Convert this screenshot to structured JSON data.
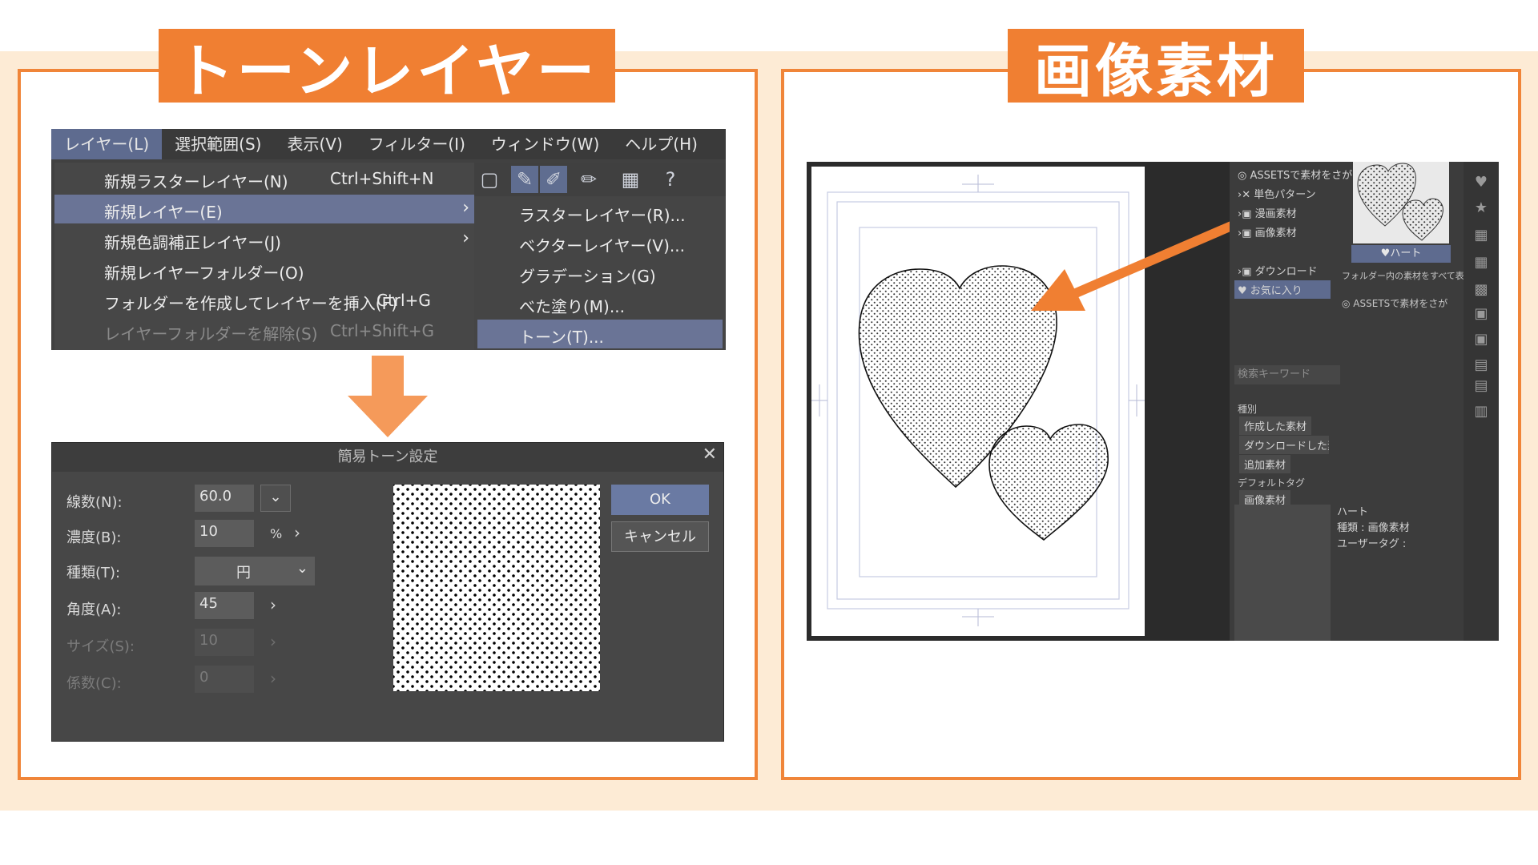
{
  "left_panel": {
    "title": "トーンレイヤー",
    "menubar": [
      "レイヤー(L)",
      "選択範囲(S)",
      "表示(V)",
      "フィルター(I)",
      "ウィンドウ(W)",
      "ヘルプ(H)"
    ],
    "layer_menu": [
      {
        "label": "新規ラスターレイヤー(N)",
        "shortcut": "Ctrl+Shift+N"
      },
      {
        "label": "新規レイヤー(E)",
        "shortcut": "",
        "has_submenu": true,
        "highlighted": true
      },
      {
        "label": "新規色調補正レイヤー(J)",
        "shortcut": "",
        "has_submenu": true
      },
      {
        "label": "新規レイヤーフォルダー(O)",
        "shortcut": ""
      },
      {
        "label": "フォルダーを作成してレイヤーを挿入(F)",
        "shortcut": "Ctrl+G"
      },
      {
        "label": "レイヤーフォルダーを解除(S)",
        "shortcut": "Ctrl+Shift+G",
        "disabled": true
      }
    ],
    "submenu": [
      {
        "label": "ラスターレイヤー(R)..."
      },
      {
        "label": "ベクターレイヤー(V)..."
      },
      {
        "label": "グラデーション(G)"
      },
      {
        "label": "べた塗り(M)..."
      },
      {
        "label": "トーン(T)...",
        "highlighted": true
      }
    ],
    "dialog": {
      "title": "簡易トーン設定",
      "close": "✕",
      "rows": [
        {
          "label": "線数(N):",
          "value": "60.0"
        },
        {
          "label": "濃度(B):",
          "value": "10",
          "unit": "%"
        },
        {
          "label": "種類(T):",
          "value": "円"
        },
        {
          "label": "角度(A):",
          "value": "45"
        },
        {
          "label": "サイズ(S):",
          "value": "10",
          "disabled": true
        },
        {
          "label": "係数(C):",
          "value": "0",
          "disabled": true
        }
      ],
      "ok_label": "OK",
      "cancel_label": "キャンセル"
    }
  },
  "right_panel": {
    "title": "画像素材",
    "material_tree": [
      {
        "label": "ASSETSで素材をさが"
      },
      {
        "label": "単色パターン"
      },
      {
        "label": "漫画素材"
      },
      {
        "label": "画像素材"
      },
      {
        "label": "ダウンロード"
      },
      {
        "label": "お気に入り",
        "selected": true
      }
    ],
    "search_placeholder": "検索キーワード",
    "kind_heading": "種別",
    "kind_tags": [
      "作成した素材",
      "ダウンロードした素材",
      "追加素材"
    ],
    "default_tag_heading": "デフォルトタグ",
    "default_tags": [
      "画像素材"
    ],
    "thumbnail_label": "♥ハート",
    "folder_note": "フォルダー内の素材をすべて表",
    "assets_link": "ASSETSで素材をさが",
    "info": {
      "name": "ハート",
      "kind": "種類 : 画像素材",
      "user_tag": "ユーザータグ :"
    }
  },
  "colors": {
    "accent": "#f07f32",
    "cream": "#fdebd5",
    "highlight": "#6a7496"
  }
}
